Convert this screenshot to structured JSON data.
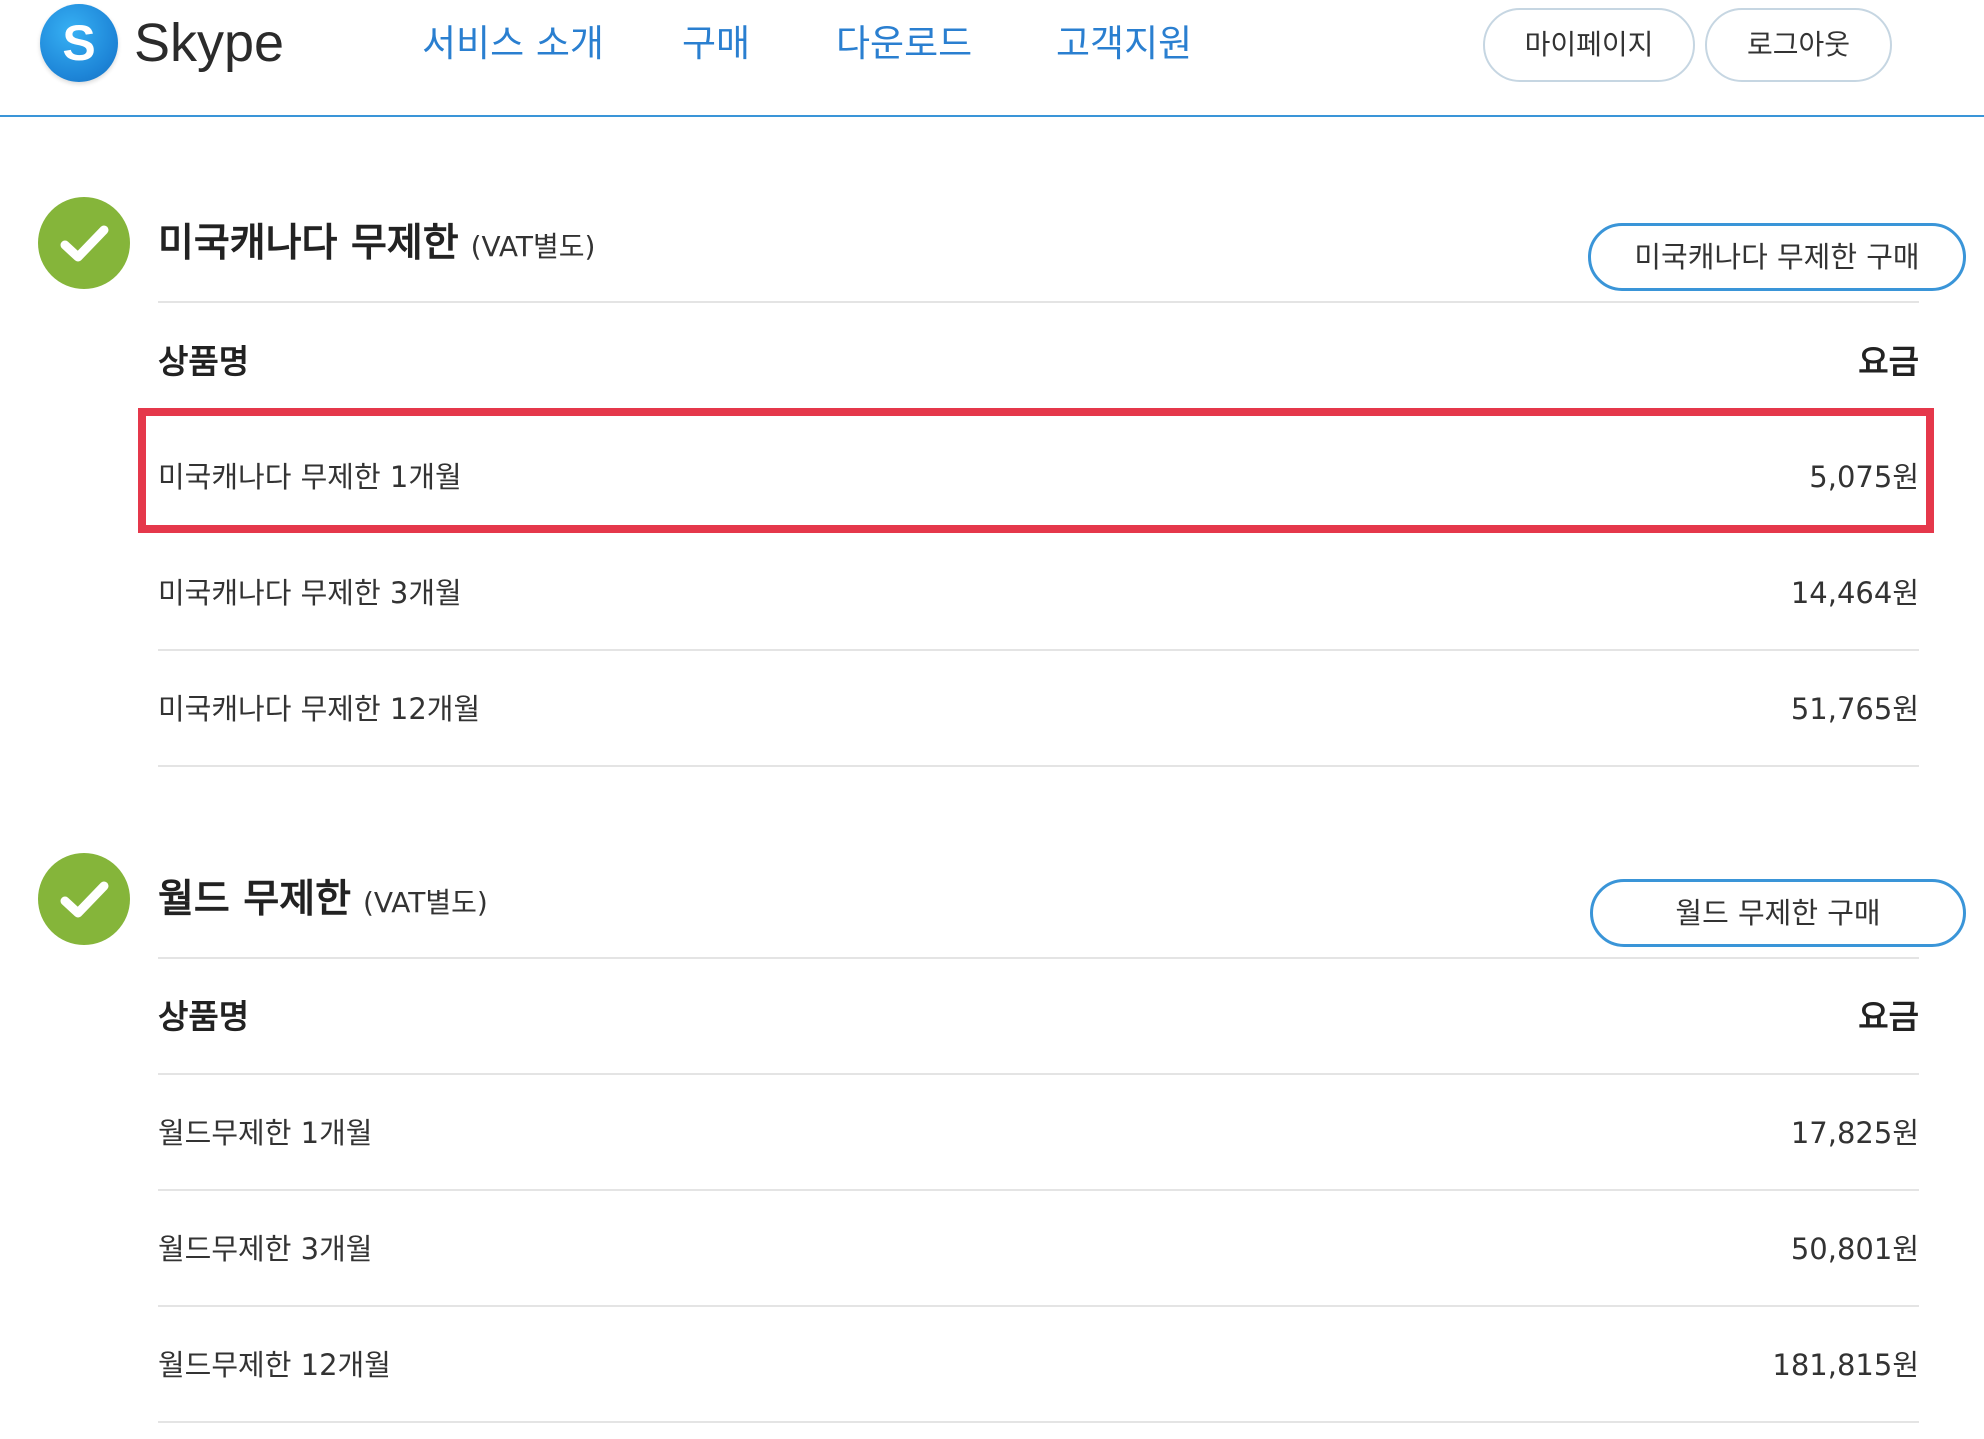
{
  "header": {
    "logo_text": "Skype",
    "logo_letter": "S",
    "nav": [
      "서비스 소개",
      "구매",
      "다운로드",
      "고객지원"
    ],
    "mypage_label": "마이페이지",
    "logout_label": "로그아웃"
  },
  "sections": [
    {
      "title": "미국캐나다 무제한",
      "vat": "(VAT별도)",
      "buy_label": "미국캐나다 무제한 구매",
      "col_name": "상품명",
      "col_price": "요금",
      "rows": [
        {
          "name": "미국캐나다 무제한 1개월",
          "price": "5,075원"
        },
        {
          "name": "미국캐나다 무제한 3개월",
          "price": "14,464원"
        },
        {
          "name": "미국캐나다 무제한 12개월",
          "price": "51,765원"
        }
      ]
    },
    {
      "title": "월드 무제한",
      "vat": "(VAT별도)",
      "buy_label": "월드 무제한 구매",
      "col_name": "상품명",
      "col_price": "요금",
      "rows": [
        {
          "name": "월드무제한 1개월",
          "price": "17,825원"
        },
        {
          "name": "월드무제한 3개월",
          "price": "50,801원"
        },
        {
          "name": "월드무제한 12개월",
          "price": "181,815원"
        }
      ]
    }
  ],
  "colors": {
    "accent": "#3a95d8",
    "check": "#85b53a",
    "highlight": "#e5384b"
  }
}
